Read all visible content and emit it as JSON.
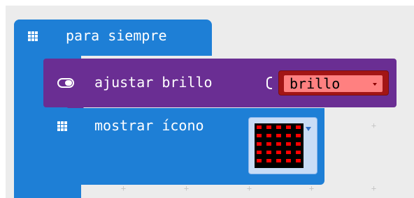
{
  "forever_block": {
    "label": "para siempre",
    "icon": "grid-icon"
  },
  "set_brightness_block": {
    "label": "ajustar brillo",
    "icon": "toggle-icon",
    "variable": {
      "value": "brillo",
      "dropdown_icon": "chevron-down-icon"
    }
  },
  "show_icon_block": {
    "label": "mostrar ícono",
    "icon": "grid-icon",
    "picker": {
      "dropdown_icon": "chevron-down-icon"
    }
  },
  "colors": {
    "basic_blue": "#1e7fd6",
    "purple": "#6a2e93",
    "variable_red": "#a31515",
    "led_red": "#ff0000"
  }
}
